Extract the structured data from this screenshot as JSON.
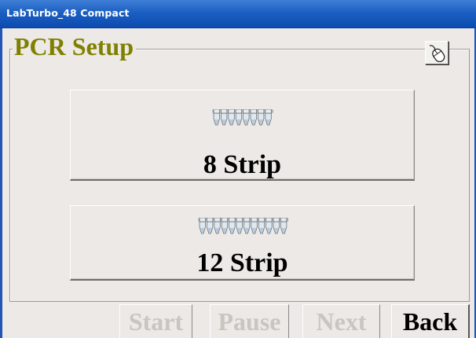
{
  "window": {
    "title": "LabTurbo_48 Compact"
  },
  "group": {
    "title": "PCR Setup"
  },
  "mouse_button": {
    "icon": "mouse-icon"
  },
  "options": [
    {
      "label": "8 Strip",
      "icon": "8-tube-strip-icon",
      "tube_count": 8
    },
    {
      "label": "12 Strip",
      "icon": "12-tube-strip-icon",
      "tube_count": 12
    }
  ],
  "nav": {
    "start": {
      "label": "Start",
      "enabled": false
    },
    "pause": {
      "label": "Pause",
      "enabled": false
    },
    "next": {
      "label": "Next",
      "enabled": false
    },
    "back": {
      "label": "Back",
      "enabled": true
    }
  },
  "colors": {
    "title_bar": "#1b5fc2",
    "group_title": "#808000",
    "disabled_text": "#c9c5c1",
    "background": "#ece9e6"
  }
}
